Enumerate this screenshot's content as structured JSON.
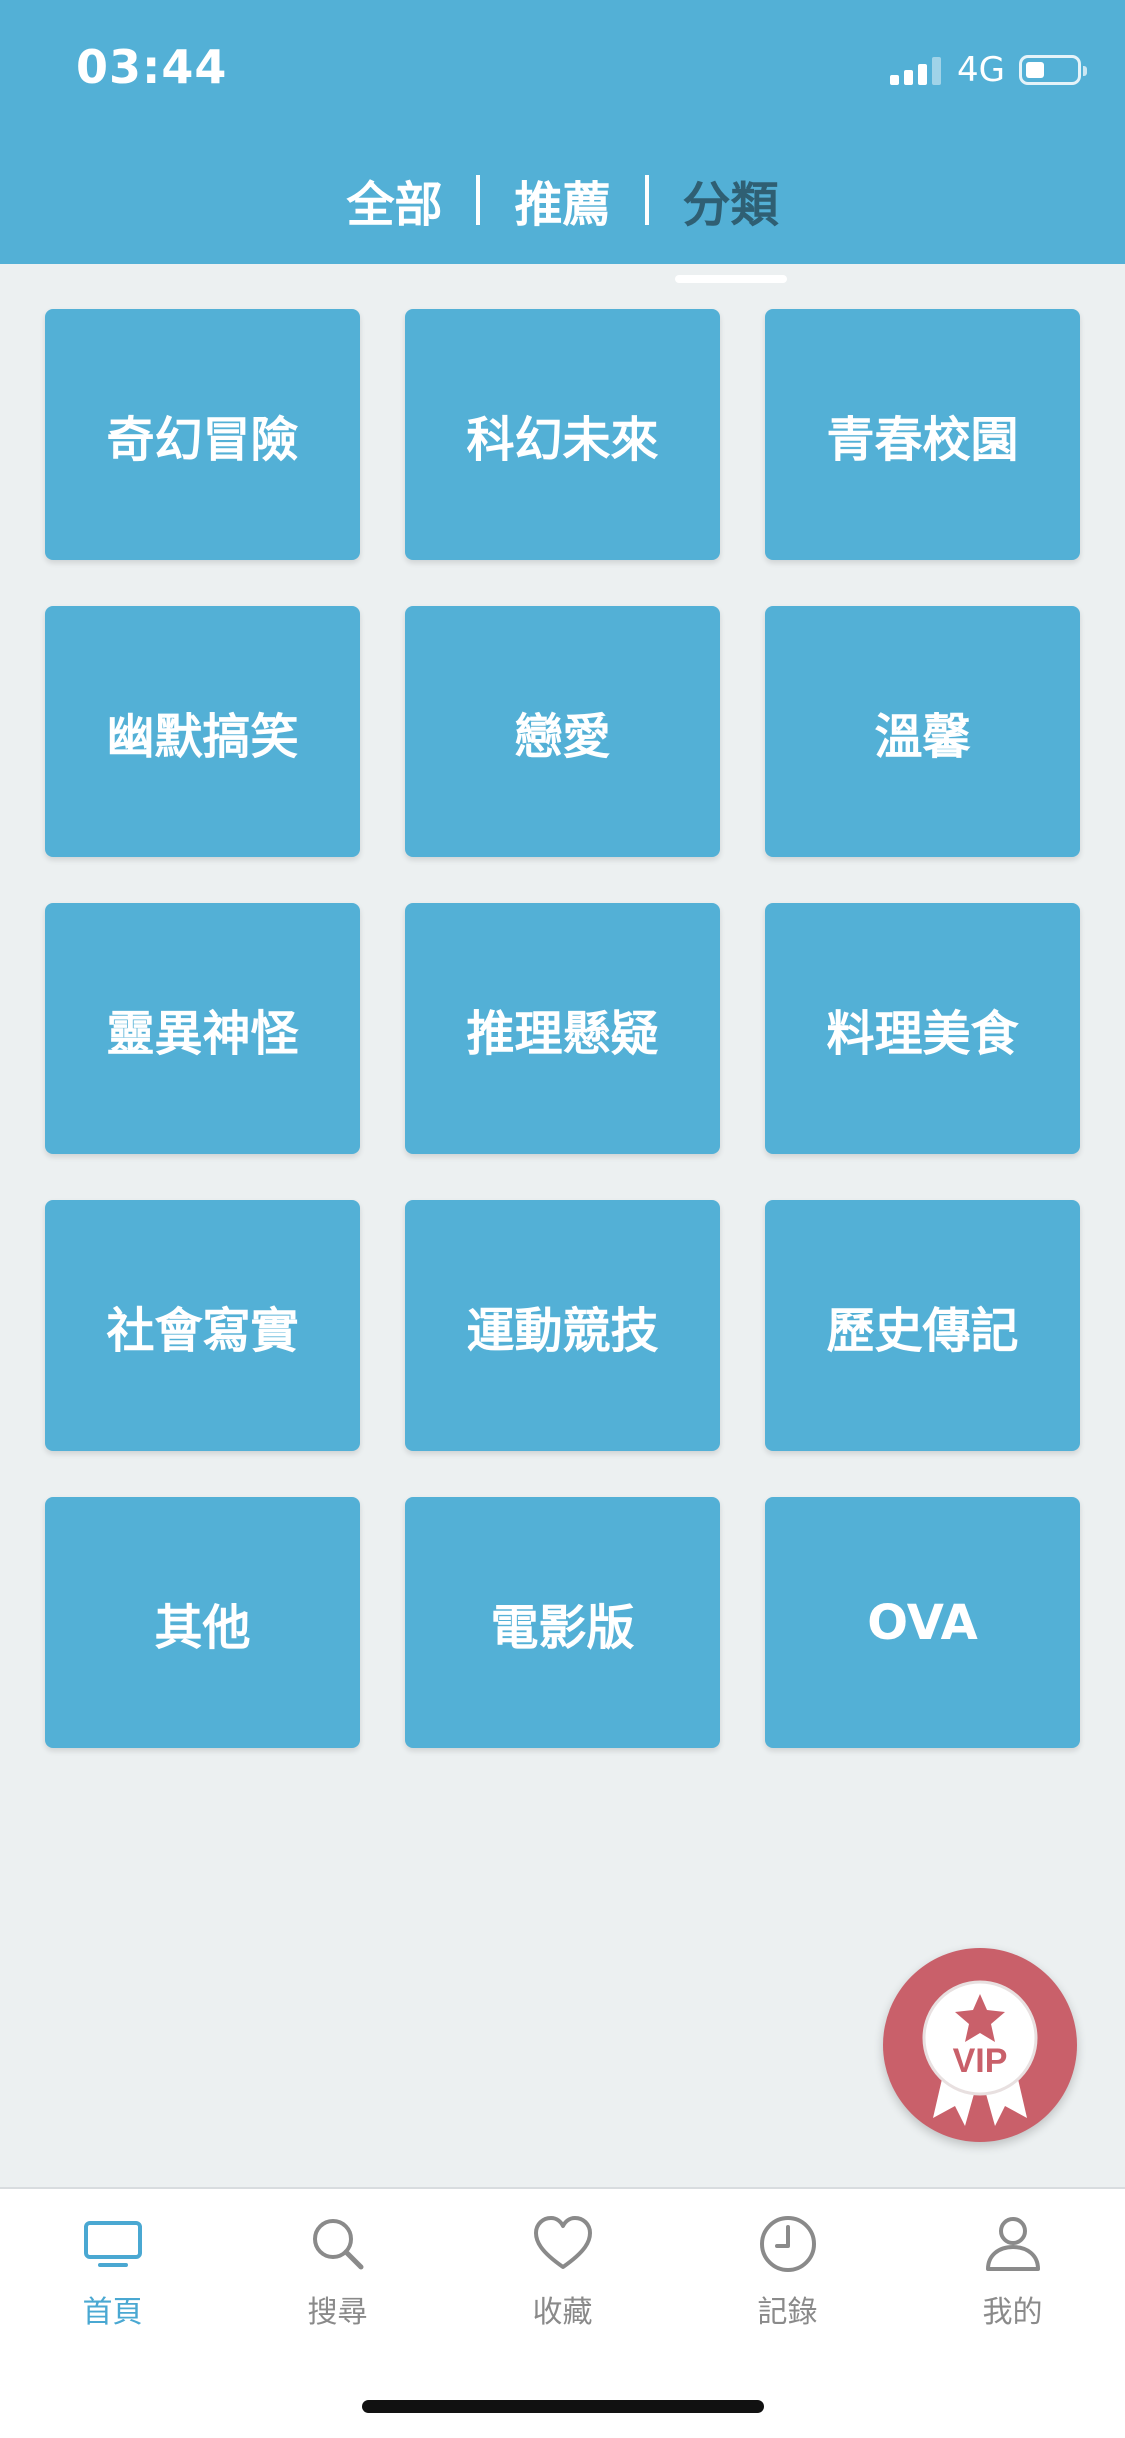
{
  "status_bar": {
    "time": "03:44",
    "network": "4G",
    "battery_icon": "battery-low-icon",
    "signal_icon": "signal-icon"
  },
  "header": {
    "tabs": [
      {
        "label": "全部",
        "active": false
      },
      {
        "label": "推薦",
        "active": false
      },
      {
        "label": "分類",
        "active": true
      }
    ]
  },
  "categories": [
    "奇幻冒險",
    "科幻未來",
    "青春校園",
    "幽默搞笑",
    "戀愛",
    "溫馨",
    "靈異神怪",
    "推理懸疑",
    "料理美食",
    "社會寫實",
    "運動競技",
    "歷史傳記",
    "其他",
    "電影版",
    "OVA"
  ],
  "vip_badge": {
    "label": "VIP",
    "icon": "vip-ribbon-star-icon",
    "color": "#c9606a"
  },
  "tab_bar": {
    "items": [
      {
        "label": "首頁",
        "icon": "tv-icon",
        "active": true
      },
      {
        "label": "搜尋",
        "icon": "search-icon",
        "active": false
      },
      {
        "label": "收藏",
        "icon": "heart-icon",
        "active": false
      },
      {
        "label": "記錄",
        "icon": "clock-icon",
        "active": false
      },
      {
        "label": "我的",
        "icon": "user-icon",
        "active": false
      }
    ]
  },
  "colors": {
    "accent": "#53b0d6",
    "active_tab_text": "#2f5f73",
    "background": "#ecf0f1",
    "tabbar_active": "#4aa8d2",
    "tabbar_inactive": "#8a8a8a"
  }
}
